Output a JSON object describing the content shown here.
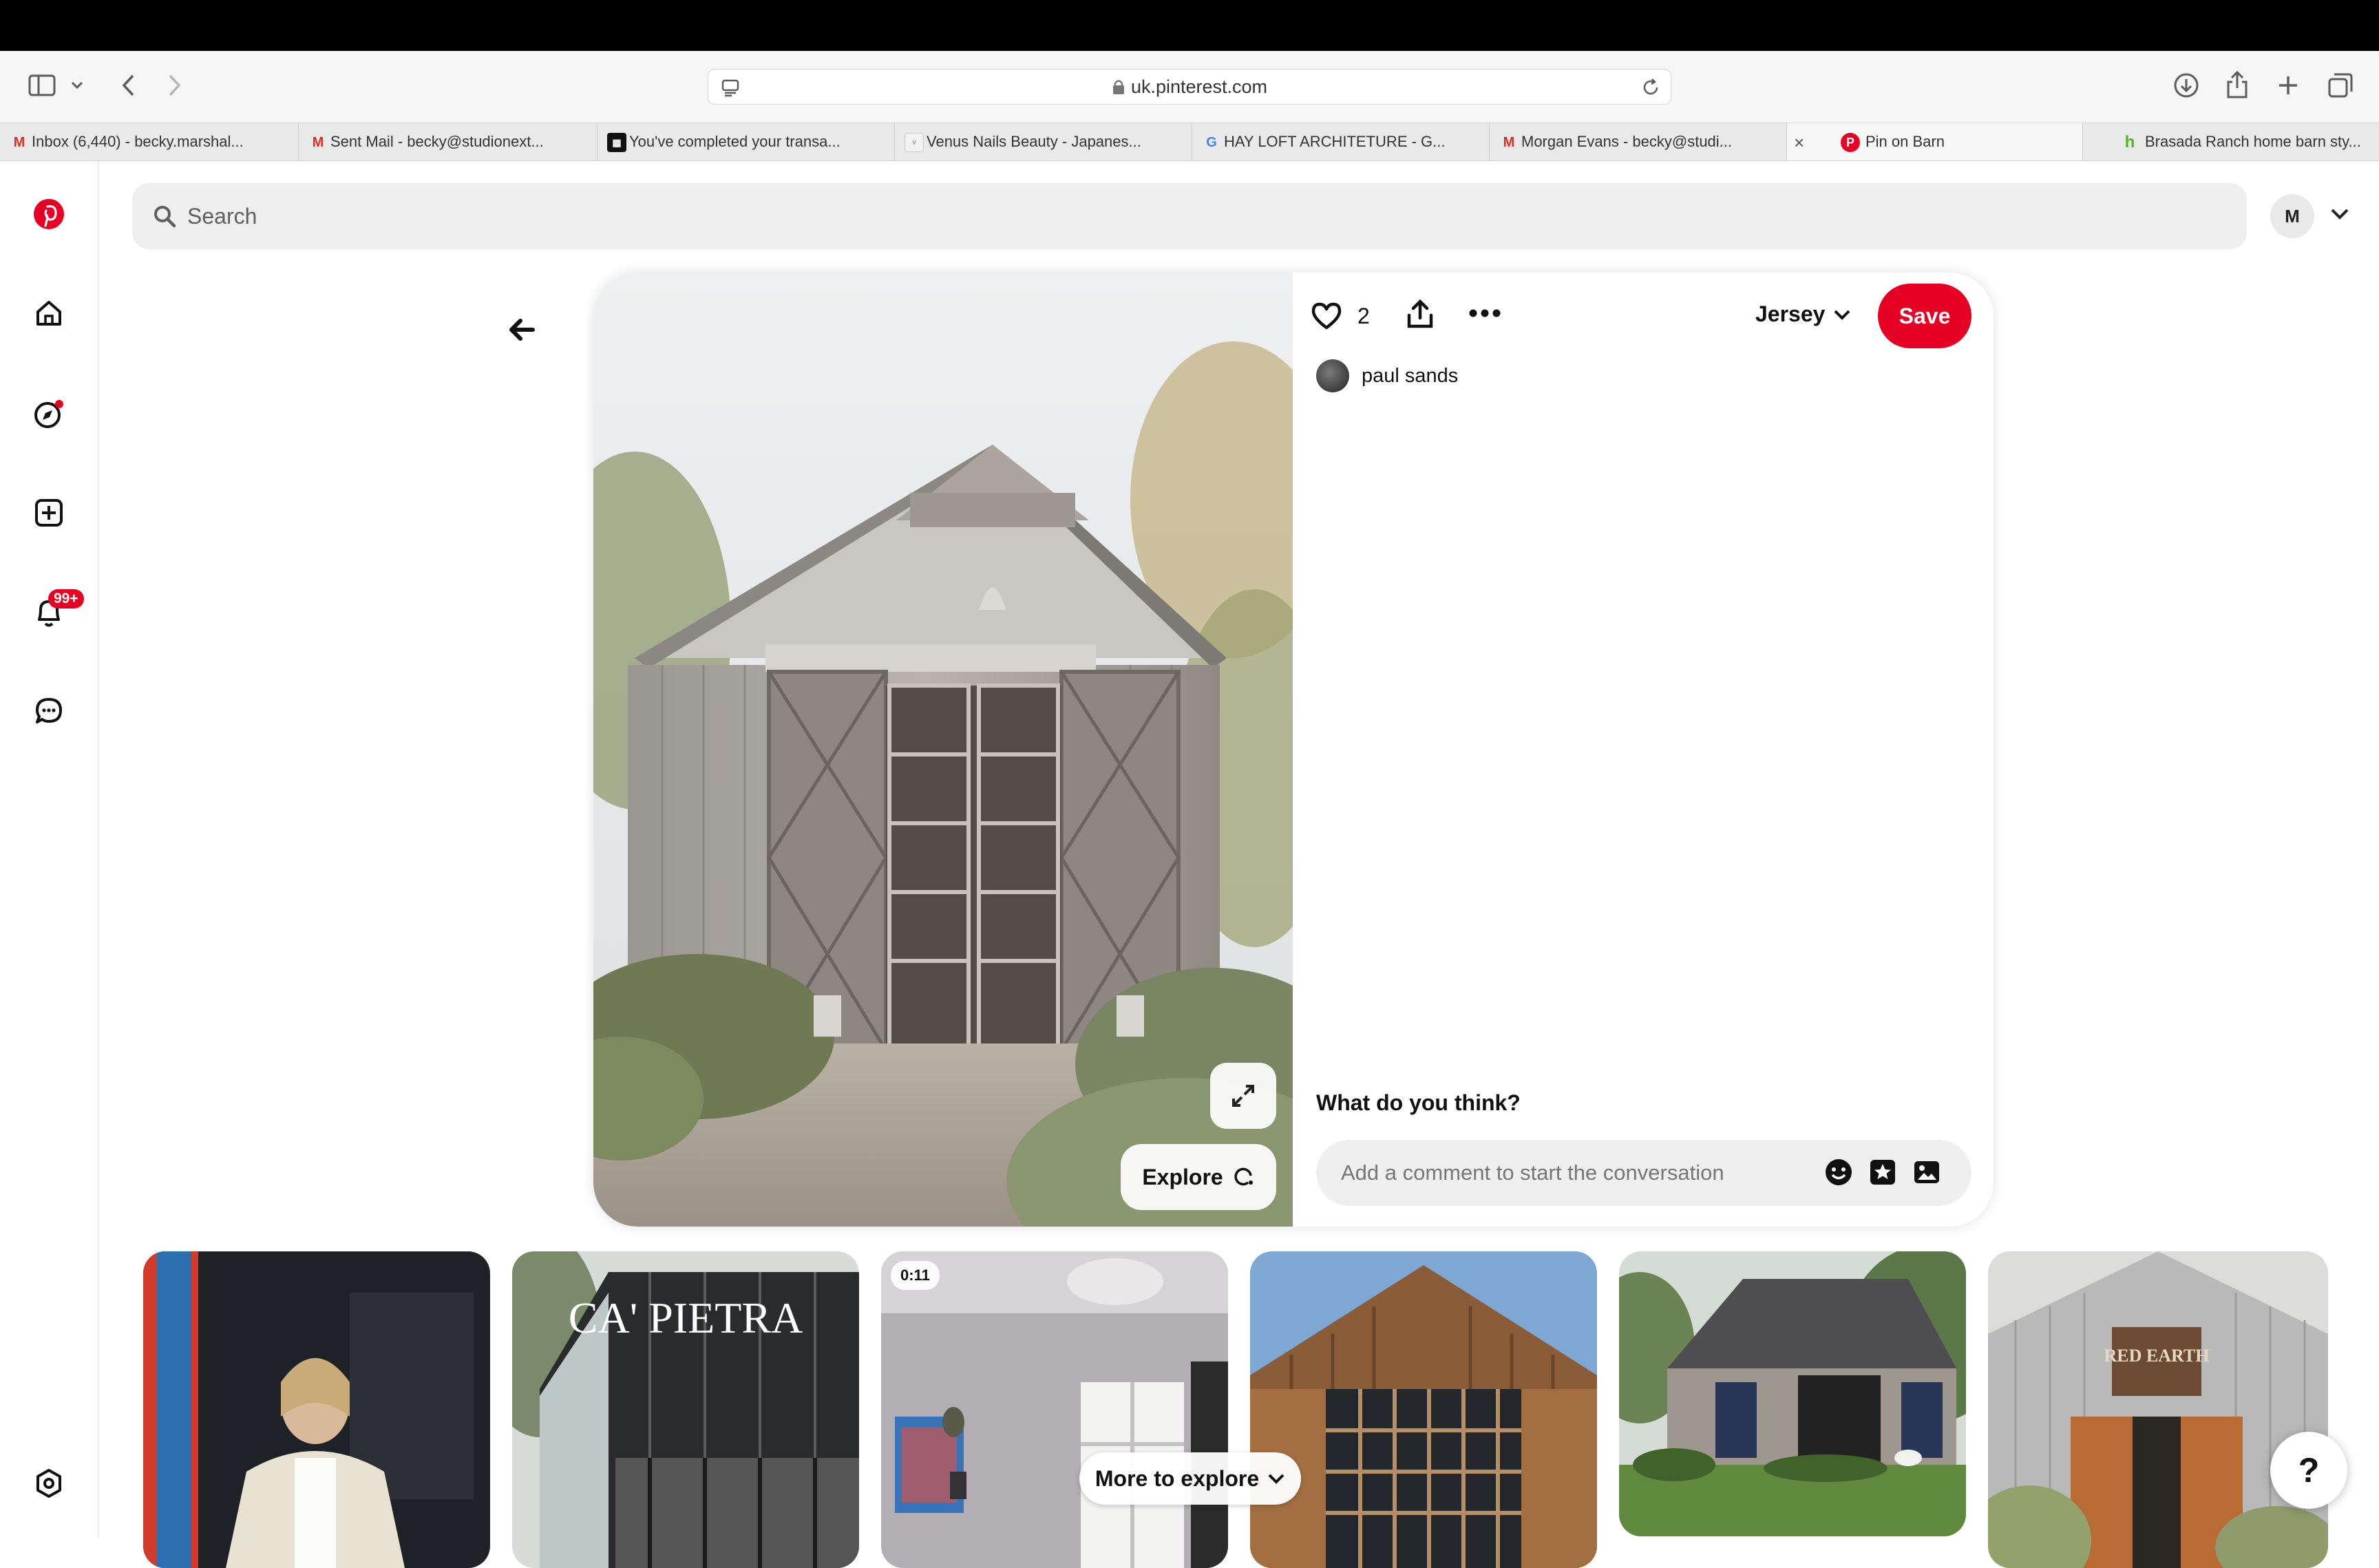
{
  "browser": {
    "url": "uk.pinterest.com",
    "tabs": [
      {
        "label": "Inbox (6,440) - becky.marshal...",
        "favicon": "gmail-icon",
        "active": false
      },
      {
        "label": "Sent Mail - becky@studionext...",
        "favicon": "gmail-icon",
        "active": false
      },
      {
        "label": "You've completed your transa...",
        "favicon": "document-icon",
        "active": false
      },
      {
        "label": "Venus Nails Beauty - Japanes...",
        "favicon": "venus-icon",
        "active": false
      },
      {
        "label": "HAY LOFT ARCHITETURE - G...",
        "favicon": "google-icon",
        "active": false
      },
      {
        "label": "Morgan Evans - becky@studi...",
        "favicon": "gmail-icon",
        "active": false
      },
      {
        "label": "Pin on Barn",
        "favicon": "pinterest-icon",
        "active": true
      },
      {
        "label": "Brasada Ranch home barn sty...",
        "favicon": "houzz-icon",
        "active": false
      }
    ]
  },
  "sidebar": {
    "notifications_badge": "99+"
  },
  "search": {
    "placeholder": "Search"
  },
  "header": {
    "avatar_initial": "M"
  },
  "pin": {
    "likes": "2",
    "board": "Jersey",
    "save_label": "Save",
    "author": "paul sands",
    "explore_label": "Explore",
    "comment_prompt": "What do you think?",
    "comment_placeholder": "Add a comment to start the conversation"
  },
  "grid": {
    "video_duration": "0:11",
    "thumb2_text": "CA' PIETRA",
    "thumb6_sign": "RED EARTH",
    "more_label": "More to explore"
  },
  "help_label": "?",
  "colors": {
    "brand": "#e60023",
    "search_bg": "#efefef"
  }
}
